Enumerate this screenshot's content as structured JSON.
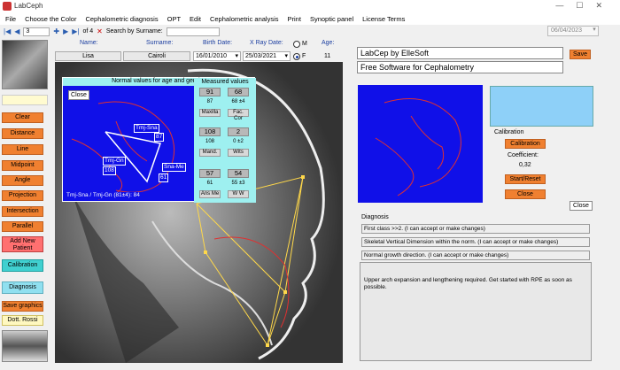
{
  "window": {
    "title": "LabCeph"
  },
  "menu": [
    "File",
    "Choose the Color",
    "Cephalometric diagnosis",
    "OPT",
    "Edit",
    "Cephalometric analysis",
    "Print",
    "Synoptic panel",
    "License Terms"
  ],
  "toolbar": {
    "record": "3",
    "of_label": "of 4",
    "search_label": "Search by Surname:",
    "search_value": "",
    "date": "06/04/2023"
  },
  "patient": {
    "name_label": "Name:",
    "name": "Lisa",
    "surname_label": "Surname:",
    "surname": "Cairoli",
    "birth_label": "Birth Date:",
    "birth": "16/01/2010",
    "xray_label": "X Ray Date:",
    "xray": "25/03/2021",
    "sex_m": "M",
    "sex_f": "F",
    "sex_selected": "F",
    "age_label": "Age:",
    "age": "11"
  },
  "left_buttons": [
    "Clear",
    "Distance",
    "Line",
    "Midpoint",
    "Angle",
    "Projection",
    "Intersection",
    "Parallel",
    "Add New Patient",
    "Calibration",
    "Diagnosis",
    "Save graphics",
    "Dott. Rossi"
  ],
  "normal_values": {
    "title": "Normal values for age and gender",
    "close": "Close",
    "measured_title": "Measured values",
    "rows": [
      {
        "a": "91",
        "b": "68",
        "sa": "87",
        "sb": "68 ±4",
        "la": "Maxilla",
        "lb": "Fac. Cor"
      },
      {
        "a": "108",
        "b": "2",
        "sa": "108",
        "sb": "0 ±2",
        "la": "Mand.",
        "lb": "Wits"
      },
      {
        "a": "57",
        "b": "54",
        "sa": "61",
        "sb": "55 ±3",
        "la": "Ans Me",
        "lb": "W W"
      }
    ],
    "tags": {
      "sna": "Tmj-Sna",
      "sna_val": "87",
      "gn": "Tmj-Gn",
      "gn_val": "108",
      "me": "Sna-Me",
      "me_val": "61"
    },
    "ratio": "Tmj-Sna / Tmj-Gn (81±4): 84"
  },
  "right": {
    "brand": "LabCep by ElleSoft",
    "subtitle": "Free Software for Cephalometry",
    "save": "Save",
    "calib_title": "Calibration",
    "calib_btn": "Calibration",
    "coef_label": "Coefficient:",
    "coef_value": "0,32",
    "start_reset": "Start/Reset",
    "close": "Close",
    "close2": "Close",
    "diagnosis_title": "Diagnosis",
    "diag_lines": [
      "First class >>2.     (I can accept or make changes)",
      "Skeletal Vertical Dimension within the norm.  (I can accept or make changes)",
      "Normal growth direction.  (I can accept or make changes)"
    ],
    "diag_text": "Upper arch expansion and lengthening required.  Get started with RPE as soon as possible."
  }
}
